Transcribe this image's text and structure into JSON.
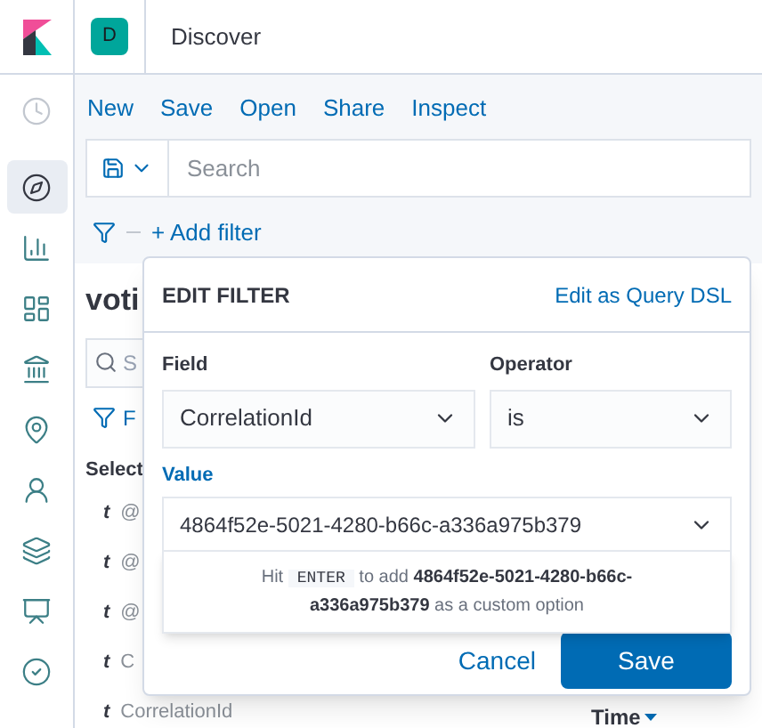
{
  "header": {
    "space_badge": "D",
    "title": "Discover"
  },
  "sidebar": {
    "items": [
      {
        "selected": false
      },
      {
        "selected": true
      },
      {
        "selected": false
      },
      {
        "selected": false
      },
      {
        "selected": false
      },
      {
        "selected": false
      },
      {
        "selected": false
      },
      {
        "selected": false
      },
      {
        "selected": false
      },
      {
        "selected": false
      }
    ]
  },
  "menu": [
    "New",
    "Save",
    "Open",
    "Share",
    "Inspect"
  ],
  "search": {
    "placeholder": "Search"
  },
  "add_filter": "+ Add filter",
  "background_panel": {
    "index_title": "voti",
    "search_hint": "S",
    "filter_label": "F",
    "section_label": "Select",
    "fields": [
      {
        "type": "t",
        "name": "@"
      },
      {
        "type": "t",
        "name": "@"
      },
      {
        "type": "t",
        "name": "@"
      },
      {
        "type": "t",
        "name": "C"
      },
      {
        "type": "t",
        "name": "CorrelationId"
      }
    ],
    "sort_column": "Time"
  },
  "edit_filter": {
    "title": "EDIT FILTER",
    "dsl_link": "Edit as Query DSL",
    "field": {
      "label": "Field",
      "value": "CorrelationId"
    },
    "operator": {
      "label": "Operator",
      "value": "is"
    },
    "value": {
      "label": "Value",
      "value": "4864f52e-5021-4280-b66c-a336a975b379"
    },
    "hint": {
      "before": "Hit",
      "key": "ENTER",
      "after": "to add **4864f52e-5021-4280-b66c-a336a975b379** as a custom option"
    },
    "buttons": {
      "cancel": "Cancel",
      "save": "Save"
    }
  }
}
